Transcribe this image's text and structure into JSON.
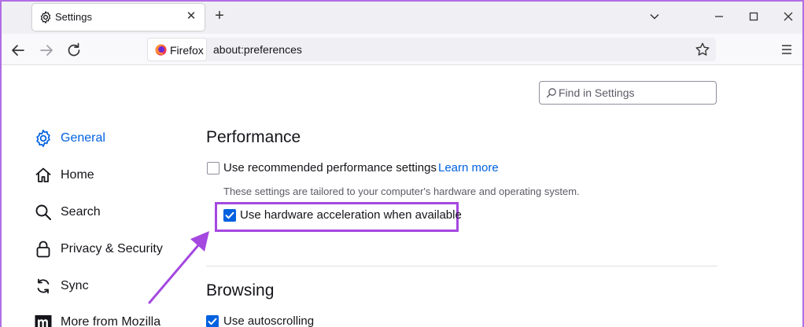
{
  "browser": {
    "tab_title": "Settings",
    "identity_label": "Firefox",
    "url": "about:preferences"
  },
  "search": {
    "placeholder": "Find in Settings"
  },
  "sidebar": {
    "items": [
      {
        "label": "General",
        "icon": "gear-icon",
        "active": true
      },
      {
        "label": "Home",
        "icon": "home-icon"
      },
      {
        "label": "Search",
        "icon": "search-icon"
      },
      {
        "label": "Privacy & Security",
        "icon": "lock-icon"
      },
      {
        "label": "Sync",
        "icon": "sync-icon"
      },
      {
        "label": "More from Mozilla",
        "icon": "mozilla-icon"
      }
    ]
  },
  "performance": {
    "title": "Performance",
    "recommended_label": "Use recommended performance settings",
    "recommended_checked": false,
    "learn_more": "Learn more",
    "description": "These settings are tailored to your computer's hardware and operating system.",
    "hw_accel_label": "Use hardware acceleration when available",
    "hw_accel_checked": true
  },
  "browsing": {
    "title": "Browsing",
    "autoscroll_label": "Use autoscrolling",
    "autoscroll_checked": true
  },
  "colors": {
    "accent": "#0061e0",
    "highlight": "#a448e0"
  }
}
